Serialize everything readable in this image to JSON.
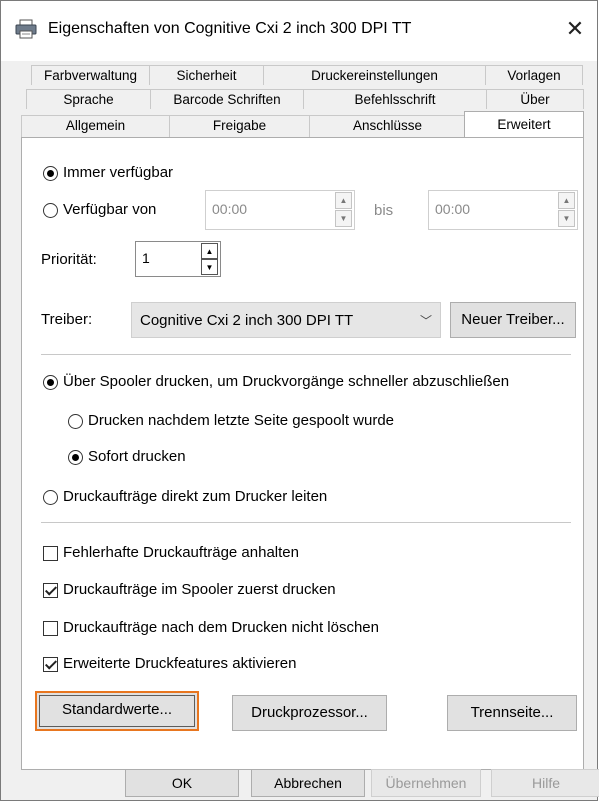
{
  "window": {
    "title": "Eigenschaften von Cognitive Cxi 2 inch 300 DPI TT",
    "close_glyph": "✕"
  },
  "tabs": {
    "row1": [
      "Farbverwaltung",
      "Sicherheit",
      "Druckereinstellungen",
      "Vorlagen"
    ],
    "row2": [
      "Sprache",
      "Barcode Schriften",
      "Befehlsschrift",
      "Über"
    ],
    "row3": [
      "Allgemein",
      "Freigabe",
      "Anschlüsse",
      "Erweitert"
    ]
  },
  "availability": {
    "always_label": "Immer verfügbar",
    "from_label": "Verfügbar von",
    "from_value": "00:00",
    "until_label": "bis",
    "until_value": "00:00"
  },
  "priority": {
    "label": "Priorität:",
    "value": "1"
  },
  "driver": {
    "label": "Treiber:",
    "selected": "Cognitive Cxi 2 inch 300 DPI TT",
    "new_driver_button": "Neuer Treiber..."
  },
  "spool": {
    "spooler_label": "Über Spooler drucken, um Druckvorgänge schneller abzuschließen",
    "after_last_page_label": "Drucken nachdem letzte Seite gespoolt wurde",
    "immediate_label": "Sofort drucken",
    "direct_label": "Druckaufträge direkt zum Drucker leiten"
  },
  "options": {
    "hold_mismatched": "Fehlerhafte Druckaufträge anhalten",
    "spooled_first": "Druckaufträge im Spooler zuerst drucken",
    "keep_printed": "Druckaufträge nach dem Drucken nicht löschen",
    "advanced_features": "Erweiterte Druckfeatures aktivieren"
  },
  "panel_buttons": {
    "defaults": "Standardwerte...",
    "processor": "Druckprozessor...",
    "separator": "Trennseite..."
  },
  "dialog_buttons": {
    "ok": "OK",
    "cancel": "Abbrechen",
    "apply": "Übernehmen",
    "help": "Hilfe"
  },
  "icons": {
    "title": "printer-icon",
    "close": "close-icon",
    "combo": "chevron-down-icon"
  },
  "colors": {
    "focus": "#e8761f",
    "panel": "#ffffff",
    "window": "#f0f0f0"
  }
}
